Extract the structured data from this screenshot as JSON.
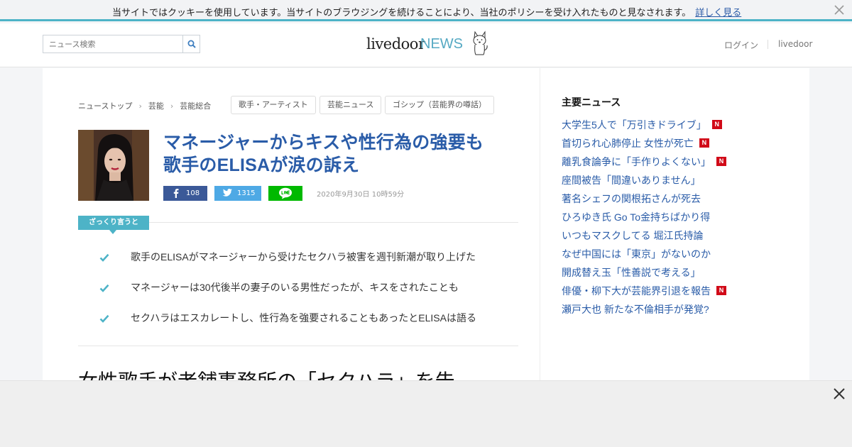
{
  "cookie_bar": {
    "text": "当サイトではクッキーを使用しています。当サイトのブラウジングを続けることにより、当社のポリシーを受け入れたものと見なされます。",
    "link_label": "詳しく見る",
    "close_icon": "close-icon"
  },
  "header": {
    "search": {
      "placeholder": "ニュース検索",
      "icon": "search-icon"
    },
    "logo": {
      "livedoor": "livedoor",
      "news": "NEWS"
    },
    "nav": {
      "login": "ログイン",
      "livedoor": "livedoor"
    }
  },
  "breadcrumb": {
    "items": [
      "ニューストップ",
      "芸能",
      "芸能総合"
    ]
  },
  "tags": [
    "歌手・アーティスト",
    "芸能ニュース",
    "ゴシップ（芸能界の噂話）"
  ],
  "article": {
    "headline_line1": "マネージャーからキスや性行為の強要も",
    "headline_line2": "歌手のELISAが涙の訴え",
    "share": {
      "facebook_count": "108",
      "twitter_count": "1315"
    },
    "date": "2020年9月30日 10時59分",
    "summary_badge": "ざっくり言うと",
    "points": [
      "歌手のELISAがマネージャーから受けたセクハラ被害を週刊新潮が取り上げた",
      "マネージャーは30代後半の妻子のいる男性だったが、キスをされたことも",
      "セクハラはエスカレートし、性行為を強要されることもあったとELISAは語る"
    ],
    "subheadline": "女性歌手が老舗事務所の「セクハラ」を告"
  },
  "sidebar": {
    "title": "主要ニュース",
    "items": [
      {
        "text": "大学生5人で「万引きドライブ」",
        "new": "N"
      },
      {
        "text": "首切られ心肺停止 女性が死亡",
        "new": "N"
      },
      {
        "text": "離乳食論争に「手作りよくない」",
        "new": "N"
      },
      {
        "text": "座間被告「間違いありません」",
        "new": ""
      },
      {
        "text": "著名シェフの関根拓さんが死去",
        "new": ""
      },
      {
        "text": "ひろゆき氏 Go To金持ちばかり得",
        "new": ""
      },
      {
        "text": "いつもマスクしてる 堀江氏持論",
        "new": ""
      },
      {
        "text": "なぜ中国には「東京」がないのか",
        "new": ""
      },
      {
        "text": "開成替え玉「性善説で考える」",
        "new": ""
      },
      {
        "text": "俳優・柳下大が芸能界引退を報告",
        "new": "N"
      },
      {
        "text": "瀬戸大也 新たな不倫相手が発覚?",
        "new": ""
      }
    ]
  },
  "colors": {
    "accent": "#4db3c7",
    "link": "#2a5ca8",
    "facebook": "#3b5998",
    "twitter": "#4ea9e5",
    "line": "#00b900",
    "new_badge": "#d10a18"
  }
}
